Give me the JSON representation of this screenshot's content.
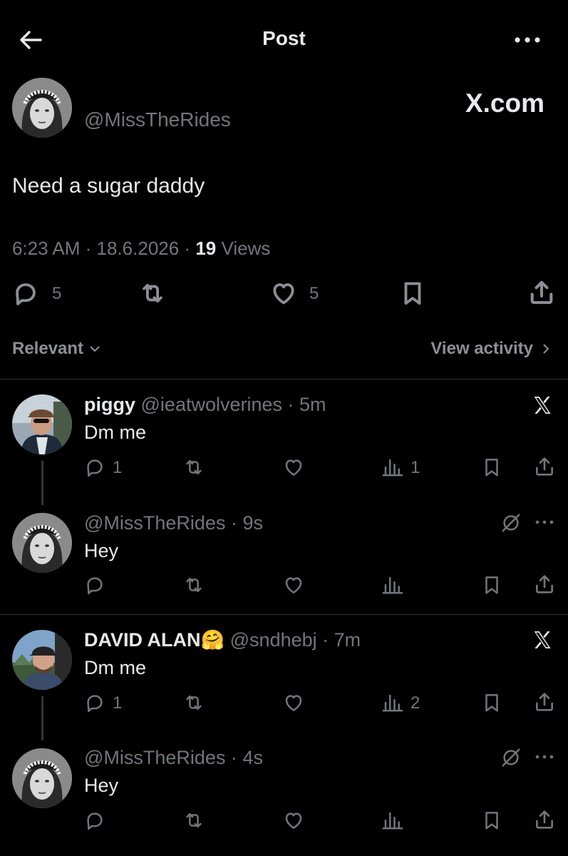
{
  "header": {
    "title": "Post"
  },
  "post": {
    "handle": "@MissTheRides",
    "watermark": "X.com",
    "text": "Need a sugar daddy",
    "time": "6:23 AM",
    "date": "18.6.2026",
    "views_count": "19",
    "views_label": "Views",
    "replies": "5",
    "likes": "5"
  },
  "filter": {
    "sort_label": "Relevant",
    "activity_label": "View activity"
  },
  "replies": [
    {
      "name": "piggy",
      "handle": "@ieatwolverines",
      "age": "5m",
      "text": "Dm me",
      "replies": "1",
      "views": "1"
    },
    {
      "handle": "@MissTheRides",
      "age": "9s",
      "text": "Hey"
    },
    {
      "name": "DAVID ALAN",
      "emoji": "🤗",
      "handle": "@sndhebj",
      "age": "7m",
      "text": "Dm me",
      "replies": "1",
      "views": "2"
    },
    {
      "handle": "@MissTheRides",
      "age": "4s",
      "text": "Hey"
    }
  ],
  "icons": [
    "back-arrow-icon",
    "more-icon",
    "reply-icon",
    "repost-icon",
    "like-icon",
    "bookmark-icon",
    "share-icon",
    "views-icon",
    "x-logo-icon",
    "no-reply-icon",
    "chevron-down-icon",
    "chevron-right-icon"
  ],
  "colors": {
    "background": "#000000",
    "text": "#e7e9ea",
    "secondary": "#71767b",
    "divider": "#2f3336"
  }
}
